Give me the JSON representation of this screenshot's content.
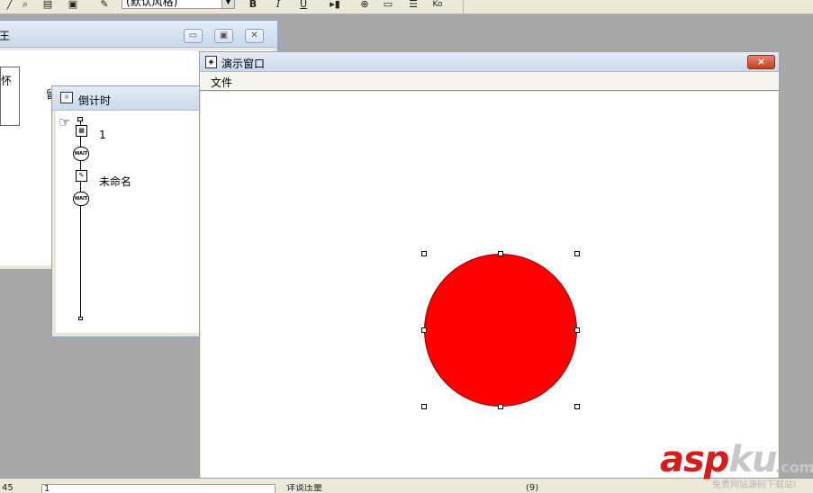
{
  "toolbar": {
    "style_combo": "(默认风格)",
    "icons": [
      "pen-icon",
      "magnify-icon",
      "copy-icon",
      "paste-icon",
      "wrench-icon",
      "bold-icon",
      "italic-icon",
      "underline-icon",
      "play-icon",
      "insert-icon",
      "text-icon",
      "list-icon",
      "ko-icon"
    ],
    "bold": "B",
    "italic": "I",
    "underline": "U",
    "ko": "Ko"
  },
  "back_window": {
    "title": "王",
    "content_char": "怀"
  },
  "stray_text": "留",
  "flow_window": {
    "title": "倒计时",
    "items": [
      {
        "kind": "calc",
        "label": "1"
      },
      {
        "kind": "wait",
        "label": "WAIT"
      },
      {
        "kind": "display",
        "label": "未命名"
      },
      {
        "kind": "wait",
        "label": "WAIT"
      }
    ]
  },
  "presentation_window": {
    "title": "演示窗口",
    "menu": [
      "文件"
    ],
    "close": "×",
    "shape": {
      "type": "circle",
      "fill": "#ff0000"
    }
  },
  "statusbar": {
    "left": "45",
    "field1": "1",
    "field2": "详谈压量",
    "field3": "(9)"
  },
  "watermark": {
    "main": "asp",
    "ku": "ku",
    "suffix": ".com",
    "tag": "免费网站源码下载站!"
  }
}
